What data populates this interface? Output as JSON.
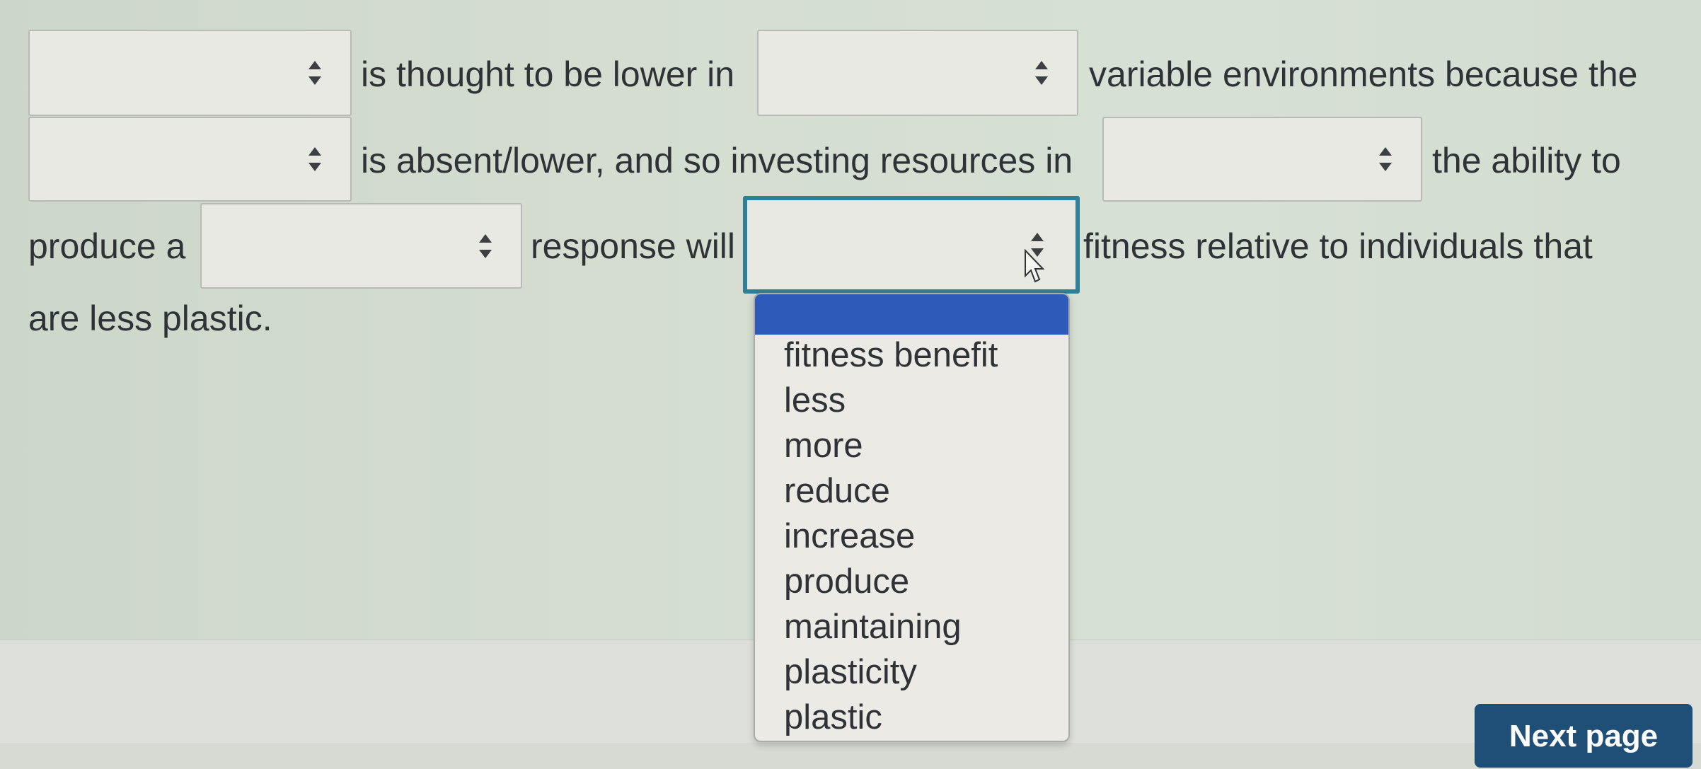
{
  "question": {
    "text_1": "is thought to be lower in",
    "text_2": "variable environments because the",
    "text_3": "is absent/lower, and so investing resources in",
    "text_4": "the ability to",
    "text_5": "produce a",
    "text_6": "response will",
    "text_7": "fitness relative to individuals that",
    "text_8": "are less plastic."
  },
  "selects": {
    "blank_1": "",
    "blank_2": "",
    "blank_3": "",
    "blank_4": "",
    "blank_5": "",
    "blank_6": ""
  },
  "dropdown": {
    "selected": "",
    "options": [
      "fitness benefit",
      "less",
      "more",
      "reduce",
      "increase",
      "produce",
      "maintaining",
      "plasticity",
      "plastic"
    ]
  },
  "navigation": {
    "next_label": "Next page"
  },
  "colors": {
    "focus_border": "#2f7f96",
    "highlight": "#2e5bb9",
    "next_button": "#1f4f76"
  },
  "icons": [
    "select-arrows-icon",
    "mouse-pointer-icon"
  ]
}
